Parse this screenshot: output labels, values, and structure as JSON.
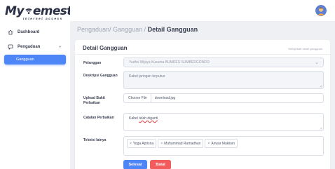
{
  "brand": {
    "name_prefix": "My",
    "name_suffix": "emesta",
    "tagline": "internet access"
  },
  "sidebar": {
    "items": [
      {
        "label": "Dashboard",
        "icon": "home-icon"
      },
      {
        "label": "Pengaduan",
        "icon": "chat-icon",
        "expanded": true
      }
    ],
    "sub_items": [
      {
        "label": "Gangguan",
        "active": true
      }
    ]
  },
  "breadcrumb": {
    "part1": "Pengaduan/ Gangguan / ",
    "current": "Detail Gangguan"
  },
  "card": {
    "title": "Detail Gangguan",
    "subtitle": "Mengubah detail gangguan"
  },
  "form": {
    "pelanggan": {
      "label": "Pelanggan",
      "value": "Yudha Wijaya Kusuma BUMDES SUMBERGONDO"
    },
    "deskripsi": {
      "label": "Deskripsi Gangguan",
      "value": "Kabel jaringan terputus"
    },
    "upload": {
      "label": "Upload Bukti Perbaikan",
      "button": "Choose File",
      "filename": "download.jpg"
    },
    "catatan": {
      "label": "Catatan Perbaikan",
      "value_before": "Kabel ",
      "value_misspelled": "telah diganti",
      "value_after": ""
    },
    "teknisi": {
      "label": "Teknisi lainya",
      "tags": [
        "Yoga Aprisna",
        "Muhammad Ramadhan",
        "Anwar Muklisin"
      ],
      "remove_symbol": "×"
    }
  },
  "actions": {
    "save": "Selesai",
    "cancel": "Batal"
  },
  "colors": {
    "primary": "#4f86f7",
    "danger": "#f25c5c",
    "background": "#eef0f3"
  }
}
